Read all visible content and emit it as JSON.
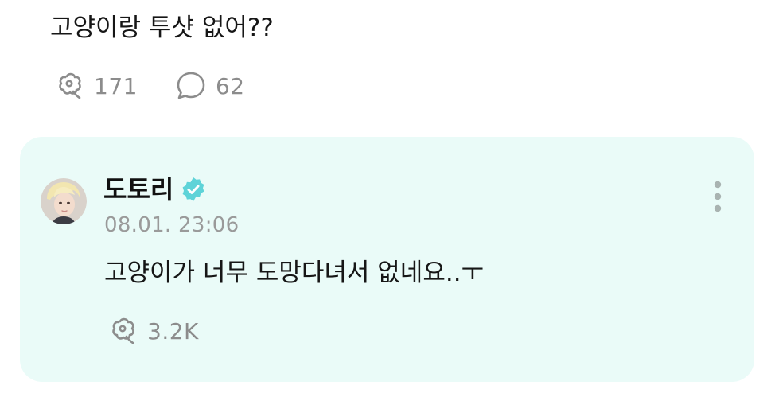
{
  "post": {
    "text": "고양이랑 투샷 없어??",
    "likes": {
      "icon": "flower-like-icon",
      "count": "171"
    },
    "comments": {
      "icon": "speech-bubble-icon",
      "count": "62"
    }
  },
  "reply": {
    "author": "도토리",
    "verified_icon": "verified-badge-icon",
    "timestamp": "08.01. 23:06",
    "text": "고양이가 너무 도망다녀서 없네요..ㅜ",
    "likes": {
      "icon": "flower-like-icon",
      "count": "3.2K"
    },
    "more_icon": "more-vertical-icon",
    "colors": {
      "card_background": "#eafbf8",
      "verified": "#5ed3d8"
    }
  }
}
